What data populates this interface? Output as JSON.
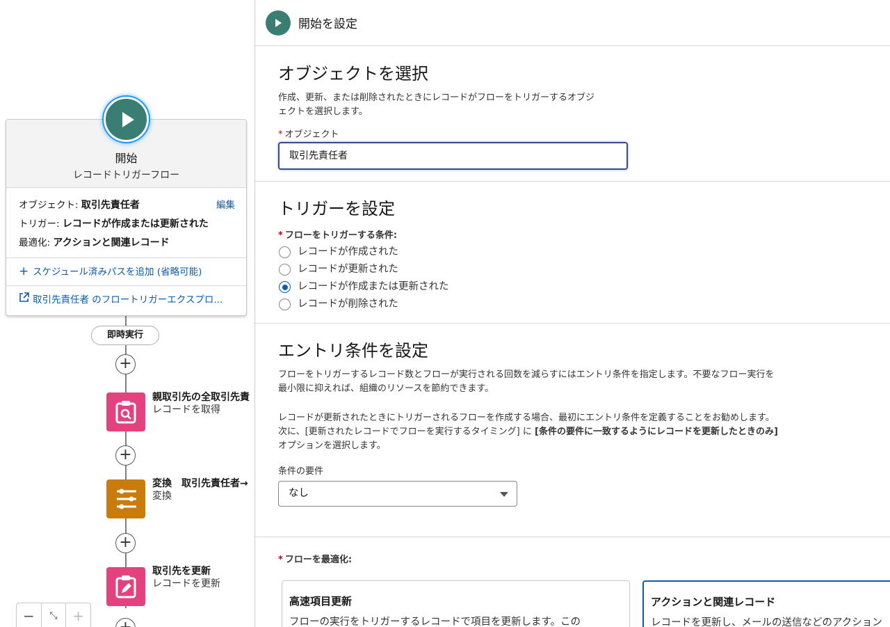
{
  "canvas": {
    "start": {
      "title": "開始",
      "subtitle": "レコードトリガーフロー",
      "object_label": "オブジェクト: ",
      "object_value": "取引先責任者",
      "edit": "編集",
      "trigger_label": "トリガー: ",
      "trigger_value": "レコードが作成または更新された",
      "optimize_label": "最適化: ",
      "optimize_value": "アクションと関連レコード",
      "add_path": "スケジュール済みパスを追加 (省略可能)",
      "explorer_link": "取引先責任者 のフロートリガーエクスプロ..."
    },
    "pill": "即時実行",
    "nodes": [
      {
        "title": "親取引先の全取引先責",
        "subtitle": "レコードを取得",
        "color": "#e3427f"
      },
      {
        "title": "変換　取引先責任者→",
        "subtitle": "変換",
        "color": "#dd7a01"
      },
      {
        "title": "取引先を更新",
        "subtitle": "レコードを更新",
        "color": "#e3427f"
      }
    ],
    "zoom": {
      "out": "−",
      "fit": "⤡",
      "in": "+"
    }
  },
  "panel": {
    "header": "開始を設定",
    "object_section": {
      "title": "オブジェクトを選択",
      "desc_line1": "作成、更新、または削除されたときにレコードがフローをトリガーするオブジ",
      "desc_line2": "ェクトを選択します。",
      "field_label": "オブジェクト",
      "field_value": "取引先責任者"
    },
    "trigger_section": {
      "title": "トリガーを設定",
      "field_label": "フローをトリガーする条件:",
      "options": [
        {
          "label": "レコードが作成された",
          "selected": false
        },
        {
          "label": "レコードが更新された",
          "selected": false
        },
        {
          "label": "レコードが作成または更新された",
          "selected": true
        },
        {
          "label": "レコードが削除された",
          "selected": false
        }
      ]
    },
    "entry_section": {
      "title": "エントリ条件を設定",
      "desc1_line1": "フローをトリガーするレコード数とフローが実行される回数を減らすにはエントリ条件を指定します。不要なフロー実行を",
      "desc1_line2": "最小限に抑えれば、組織のリソースを節約できます。",
      "desc2_line1": "レコードが更新されたときにトリガーされるフローを作成する場合、最初にエントリ条件を定義することをお勧めします。",
      "desc2_line2_a": "次に、[更新されたレコードでフローを実行するタイミング] に ",
      "desc2_line2_b": "[条件の要件に一致するようにレコードを更新したときのみ]",
      "desc2_line3": "オプションを選択します。",
      "select_label": "条件の要件",
      "select_value": "なし"
    },
    "optimize_section": {
      "field_label": "フローを最適化:",
      "cards": [
        {
          "title": "高速項目更新",
          "desc": "フローの実行をトリガーするレコードで項目を更新します。この",
          "selected": false
        },
        {
          "title": "アクションと関連レコード",
          "desc": "レコードを更新し、メールの送信などのアクション",
          "selected": true
        }
      ]
    }
  },
  "colors": {
    "accent": "#0b5cab",
    "start": "#3a7d73",
    "pink": "#e3427f",
    "orange": "#dd7a01",
    "required": "#ba0517"
  }
}
